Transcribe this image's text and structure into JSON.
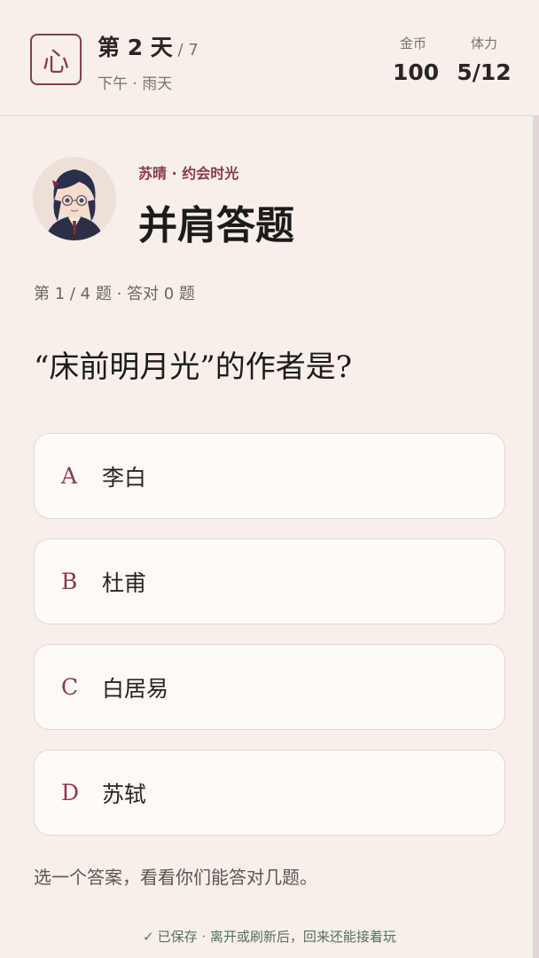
{
  "header": {
    "logo_char": "心",
    "day_label": "第 2 天",
    "day_total": " / 7",
    "subtitle": "下午 · 雨天",
    "coins_label": "金币",
    "coins_value": "100",
    "stamina_label": "体力",
    "stamina_value": "5/12"
  },
  "scene": {
    "kicker": "苏晴 · 约会时光",
    "title": "并肩答题",
    "progress": "第 1 / 4 题 · 答对 0 题",
    "question": "“床前明月光”的作者是?"
  },
  "options": [
    {
      "letter": "A",
      "text": "李白"
    },
    {
      "letter": "B",
      "text": "杜甫"
    },
    {
      "letter": "C",
      "text": "白居易"
    },
    {
      "letter": "D",
      "text": "苏轼"
    }
  ],
  "hint": "选一个答案，看看你们能答对几题。",
  "save_status": "已保存 · 离开或刷新后，回来还能接着玩",
  "colors": {
    "accent": "#8c3a4c",
    "background": "#f6efea",
    "card": "#fdfaf7"
  },
  "icons": {
    "save": "check-icon",
    "avatar": "character-portrait"
  }
}
